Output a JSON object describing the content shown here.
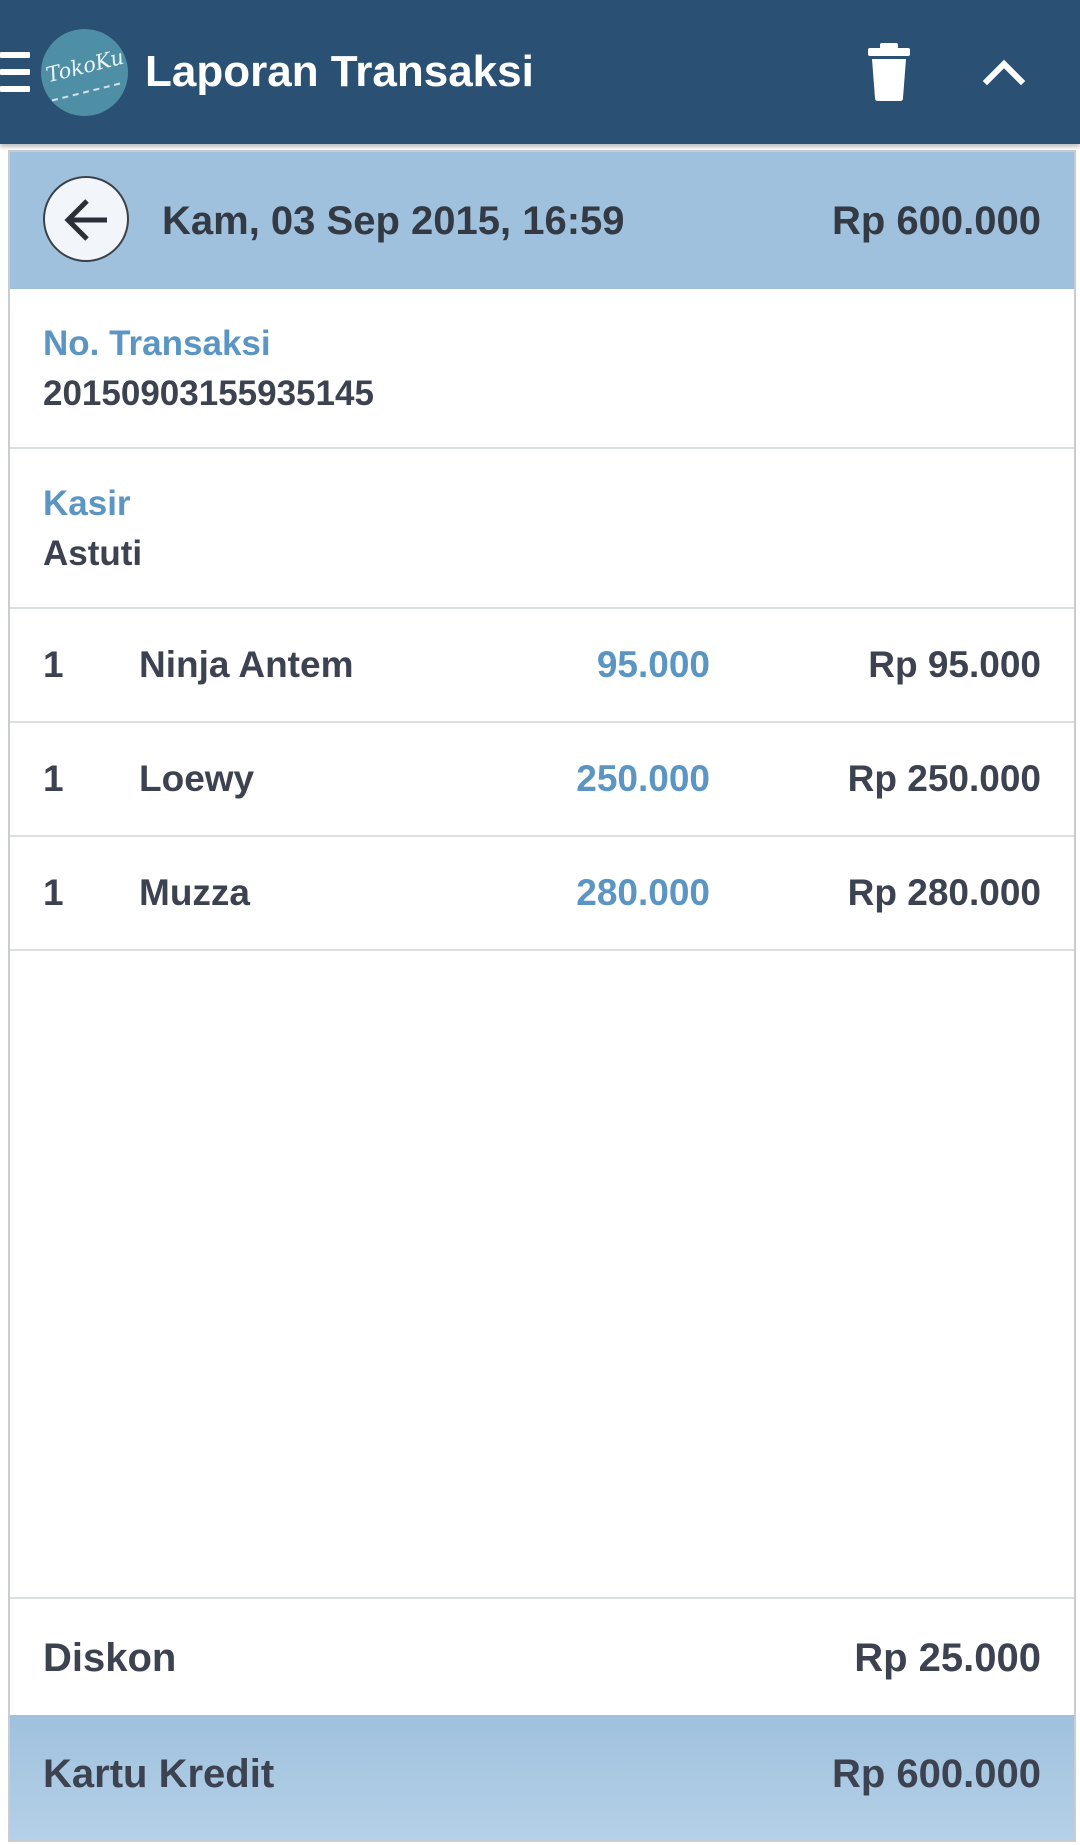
{
  "app": {
    "title": "Laporan Transaksi",
    "logo_text": "TokoKu",
    "colors": {
      "appbar": "#2a5074",
      "accent": "#5a95c3",
      "highlight": "#9fc1dd",
      "text": "#3c4250"
    },
    "icons": {
      "menu": "menu-icon",
      "delete": "trash-icon",
      "collapse": "chevron-up-icon",
      "back": "arrow-left-icon"
    }
  },
  "summary": {
    "datetime": "Kam, 03 Sep 2015, 16:59",
    "total": "Rp 600.000"
  },
  "details": [
    {
      "label": "No. Transaksi",
      "value": "20150903155935145"
    },
    {
      "label": "Kasir",
      "value": "Astuti"
    }
  ],
  "items": [
    {
      "qty": "1",
      "name": "Ninja Antem",
      "price": "95.000",
      "total": "Rp 95.000"
    },
    {
      "qty": "1",
      "name": "Loewy",
      "price": "250.000",
      "total": "Rp 250.000"
    },
    {
      "qty": "1",
      "name": "Muzza",
      "price": "280.000",
      "total": "Rp 280.000"
    }
  ],
  "discount": {
    "label": "Diskon",
    "value": "Rp 25.000"
  },
  "payment": {
    "label": "Kartu Kredit",
    "value": "Rp 600.000"
  }
}
